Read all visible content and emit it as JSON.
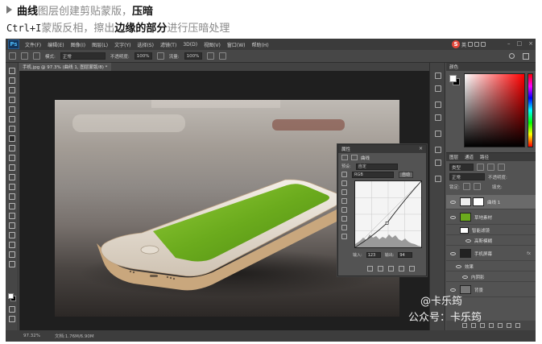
{
  "article": {
    "line1": {
      "bold1": "曲线",
      "gray1": "图层创建剪贴蒙版，",
      "bold2": "压暗"
    },
    "line2": {
      "mono": "Ctrl+I",
      "gray1": "蒙版反相，擦出",
      "bold1": "边缘的部分",
      "gray2": "进行压暗处理"
    }
  },
  "app": {
    "logo": "Ps",
    "menu": [
      "文件(F)",
      "编辑(E)",
      "图像(I)",
      "图层(L)",
      "文字(Y)",
      "选择(S)",
      "滤镜(T)",
      "3D(D)",
      "视图(V)",
      "窗口(W)",
      "帮助(H)"
    ],
    "ime": {
      "letter": "S",
      "char": "英"
    },
    "window_buttons": {
      "min": "–",
      "max": "□",
      "close": "×"
    }
  },
  "options_bar": {
    "mode_label": "模式:",
    "mode_value": "正常",
    "opacity_label": "不透明度:",
    "opacity_value": "100%",
    "flow_label": "流量:",
    "flow_value": "100%"
  },
  "document": {
    "tab_title": "手机.jpg @ 97.3% (曲线 1, 图层蒙版/8) *"
  },
  "properties": {
    "title": "属性",
    "panel_name": "曲线",
    "preset_label": "预设:",
    "preset_value": "自定",
    "channel_value": "RGB",
    "auto_label": "自动",
    "input_label": "输入:",
    "input_value": "123",
    "output_label": "输出:",
    "output_value": "94",
    "close": "×",
    "curve_point": {
      "input": 123,
      "output": 94
    }
  },
  "color_panel": {
    "title": "颜色",
    "tab2": "色板"
  },
  "layers_panel": {
    "tabs": [
      "图层",
      "通道",
      "路径"
    ],
    "kind_label": "类型",
    "blend_value": "正常",
    "opacity_label": "不透明度:",
    "lock_label": "锁定:",
    "fill_label": "填充:",
    "layers": [
      {
        "name": "曲线 1",
        "fx": ""
      },
      {
        "name": "草地素材",
        "fx": ""
      },
      {
        "name": "智能滤镜",
        "fx": ""
      },
      {
        "name": "高斯模糊",
        "fx": ""
      },
      {
        "name": "手机屏幕",
        "fx": "fx"
      },
      {
        "name": "效果",
        "fx": ""
      },
      {
        "name": "内阴影",
        "fx": ""
      },
      {
        "name": "背景",
        "fx": ""
      }
    ]
  },
  "status": {
    "zoom": "97.32%",
    "doc": "文档:1.76M/6.90M"
  },
  "watermark": {
    "line1": "@卡乐筠",
    "line2": "公众号：卡乐筠"
  },
  "colors": {
    "ps_bg": "#535353",
    "menubar": "#3b3b3b",
    "canvas_bg": "#1f1f1f",
    "grass": "#6bab1d"
  }
}
